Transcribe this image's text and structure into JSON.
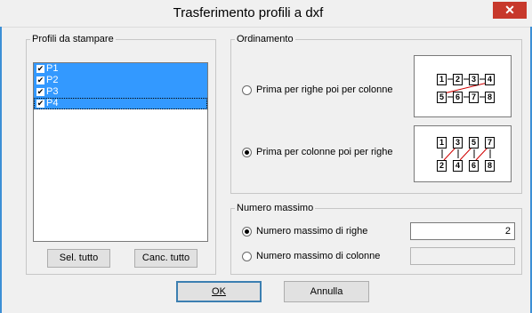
{
  "window": {
    "title": "Trasferimento profili a dxf",
    "close_glyph": "✕"
  },
  "profili": {
    "legend": "Profili da stampare",
    "items": [
      {
        "label": "P1",
        "checked": true,
        "selected": true
      },
      {
        "label": "P2",
        "checked": true,
        "selected": true
      },
      {
        "label": "P3",
        "checked": true,
        "selected": true
      },
      {
        "label": "P4",
        "checked": true,
        "selected": true
      }
    ],
    "sel_tutto": "Sel. tutto",
    "canc_tutto": "Canc. tutto"
  },
  "ordinamento": {
    "legend": "Ordinamento",
    "option_righe": "Prima per righe poi per colonne",
    "option_colonne": "Prima per colonne poi per righe",
    "selected": "colonne",
    "pic1_numbers": [
      "1",
      "2",
      "3",
      "4",
      "5",
      "6",
      "7",
      "8"
    ],
    "pic2_numbers": [
      "1",
      "3",
      "5",
      "7",
      "2",
      "4",
      "6",
      "8"
    ]
  },
  "numero_massimo": {
    "legend": "Numero massimo",
    "option_righe": "Numero massimo di righe",
    "option_colonne": "Numero massimo di colonne",
    "selected": "righe",
    "righe_value": "2",
    "colonne_value": ""
  },
  "buttons": {
    "ok": "OK",
    "annulla": "Annulla"
  },
  "colors": {
    "selection": "#3399ff",
    "close": "#c7382b",
    "arrow": "#d00000"
  }
}
